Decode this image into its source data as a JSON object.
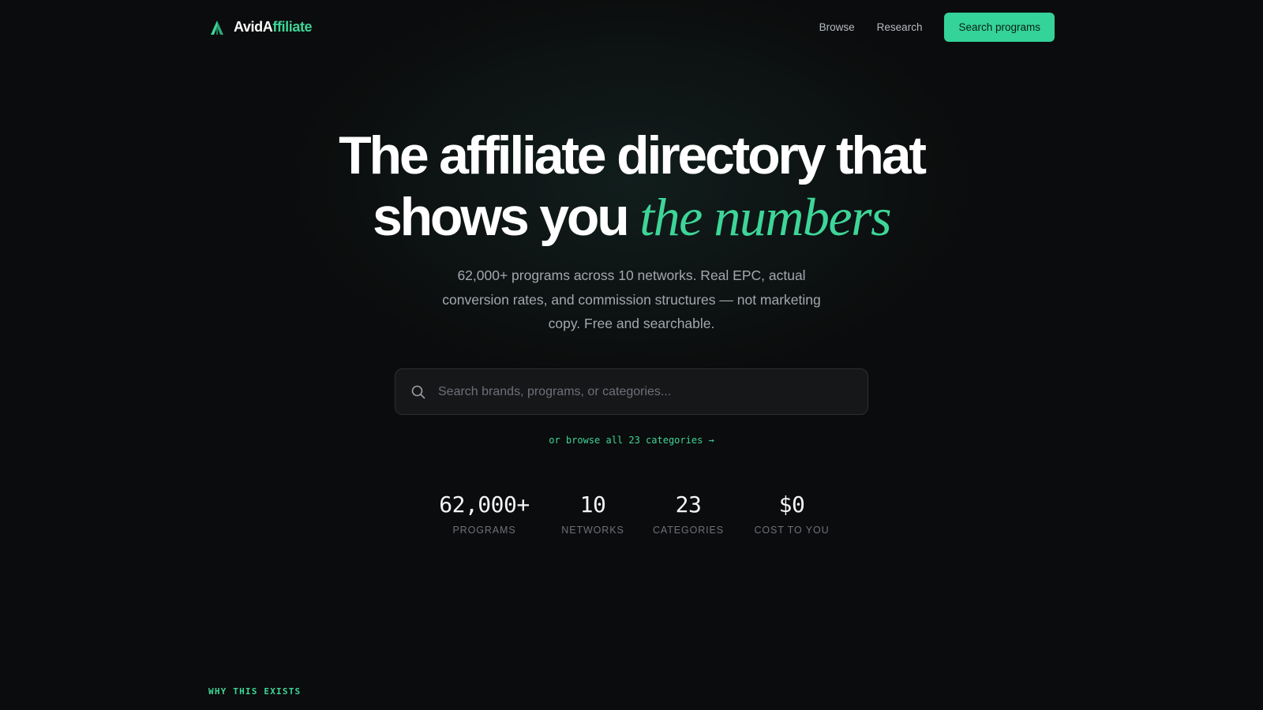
{
  "nav": {
    "brand_prefix": "AvidA",
    "brand_suffix": "ffiliate",
    "links": [
      {
        "label": "Browse"
      },
      {
        "label": "Research"
      }
    ],
    "cta_label": "Search programs"
  },
  "hero": {
    "title_line1": "The affiliate directory that",
    "title_line2_plain": "shows you ",
    "title_line2_em": "the numbers",
    "subtitle": "62,000+ programs across 10 networks. Real EPC, actual conversion rates, and commission structures — not marketing copy. Free and searchable."
  },
  "search": {
    "placeholder": "Search brands, programs, or categories...",
    "value": ""
  },
  "browse_link": "or browse all 23 categories →",
  "stats": [
    {
      "value": "62,000+",
      "label": "PROGRAMS"
    },
    {
      "value": "10",
      "label": "NETWORKS"
    },
    {
      "value": "23",
      "label": "CATEGORIES"
    },
    {
      "value": "$0",
      "label": "COST TO YOU"
    }
  ],
  "section_label": "WHY THIS EXISTS",
  "colors": {
    "accent": "#34d399",
    "background": "#0b0c0d"
  },
  "icons": {
    "brand": "avidaffiliate-logo-icon",
    "search": "search-icon"
  }
}
